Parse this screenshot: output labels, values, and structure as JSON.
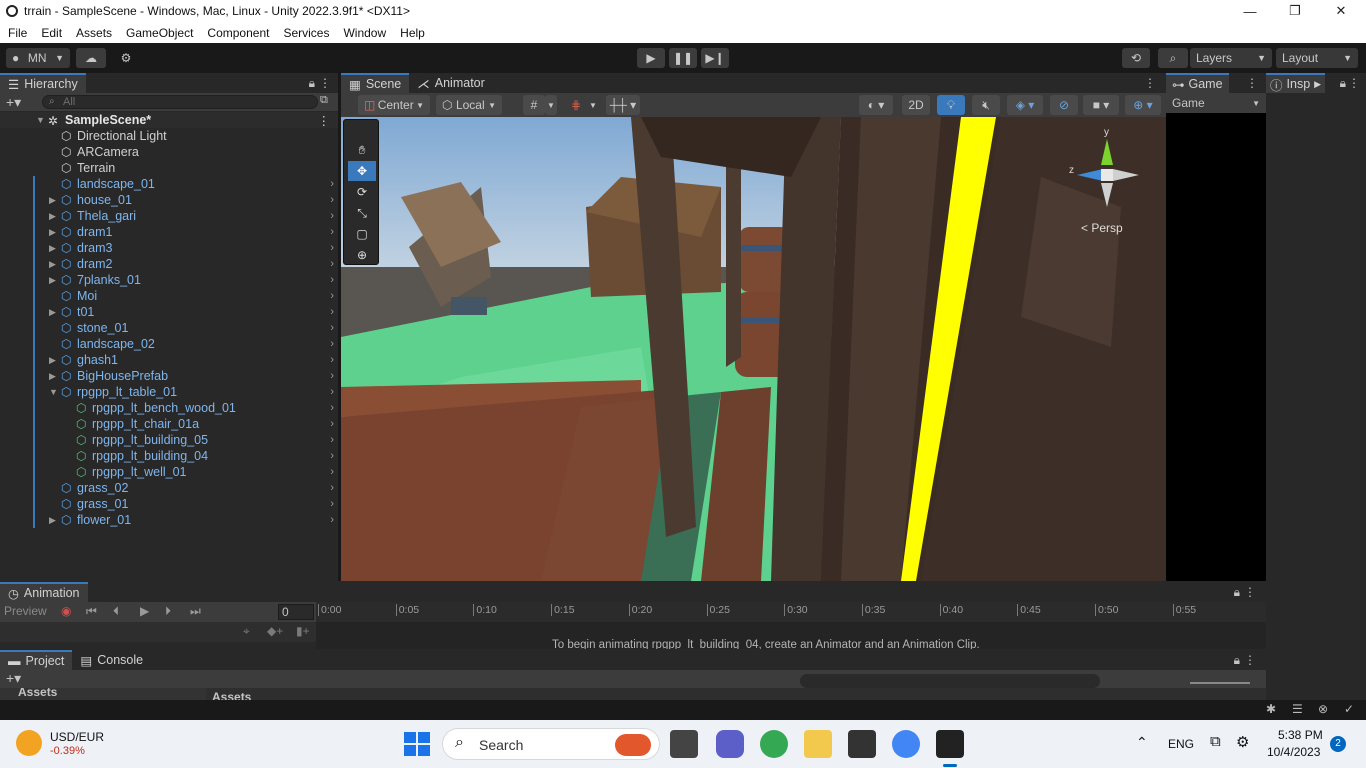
{
  "window": {
    "title": "trrain - SampleScene - Windows, Mac, Linux - Unity 2022.3.9f1* <DX11>",
    "minimize": "—",
    "maximize": "❐",
    "close": "✕"
  },
  "menu": [
    "File",
    "Edit",
    "Assets",
    "GameObject",
    "Component",
    "Services",
    "Window",
    "Help"
  ],
  "toolbar": {
    "account": "MN",
    "layers": "Layers",
    "layout": "Layout"
  },
  "hierarchy": {
    "title": "Hierarchy",
    "search_placeholder": "All",
    "scene": "SampleScene*",
    "items": [
      {
        "label": "Directional Light"
      },
      {
        "label": "ARCamera"
      },
      {
        "label": "Terrain"
      },
      {
        "label": "landscape_01"
      },
      {
        "label": "house_01"
      },
      {
        "label": "Thela_gari"
      },
      {
        "label": "dram1"
      },
      {
        "label": "dram3"
      },
      {
        "label": "dram2"
      },
      {
        "label": "7planks_01"
      },
      {
        "label": "Moi"
      },
      {
        "label": "t01"
      },
      {
        "label": "stone_01"
      },
      {
        "label": "landscape_02"
      },
      {
        "label": "ghash1"
      },
      {
        "label": "BigHousePrefab"
      },
      {
        "label": "rpgpp_lt_table_01"
      },
      {
        "label": "rpgpp_lt_bench_wood_01"
      },
      {
        "label": "rpgpp_lt_chair_01a"
      },
      {
        "label": "rpgpp_lt_building_05"
      },
      {
        "label": "rpgpp_lt_building_04"
      },
      {
        "label": "rpgpp_lt_well_01"
      },
      {
        "label": "grass_02"
      },
      {
        "label": "grass_01"
      },
      {
        "label": "flower_01"
      }
    ]
  },
  "scene_view": {
    "tab_scene": "Scene",
    "tab_animator": "Animator",
    "pivot": "Center",
    "space": "Local",
    "mode_2d": "2D",
    "gizmo_y": "y",
    "gizmo_z": "z",
    "persp": "Persp"
  },
  "game_panel": {
    "tab": "Game",
    "dropdown": "Game"
  },
  "inspector": {
    "tab": "Insp"
  },
  "animation": {
    "tab": "Animation",
    "preview": "Preview",
    "frame": "0",
    "ticks": [
      "0:00",
      "0:05",
      "0:10",
      "0:15",
      "0:20",
      "0:25",
      "0:30",
      "0:35",
      "0:40",
      "0:45",
      "0:50",
      "0:55"
    ],
    "message": "To begin animating rpgpp_lt_building_04, create an Animator and an Animation Clip."
  },
  "project": {
    "tab_project": "Project",
    "tab_console": "Console",
    "assets_left": "Assets",
    "assets_right": "Assets"
  },
  "taskbar": {
    "ticker": "USD/EUR",
    "ticker_change": "-0.39%",
    "search": "Search",
    "lang": "ENG",
    "time": "5:38 PM",
    "date": "10/4/2023",
    "notif": "2"
  }
}
